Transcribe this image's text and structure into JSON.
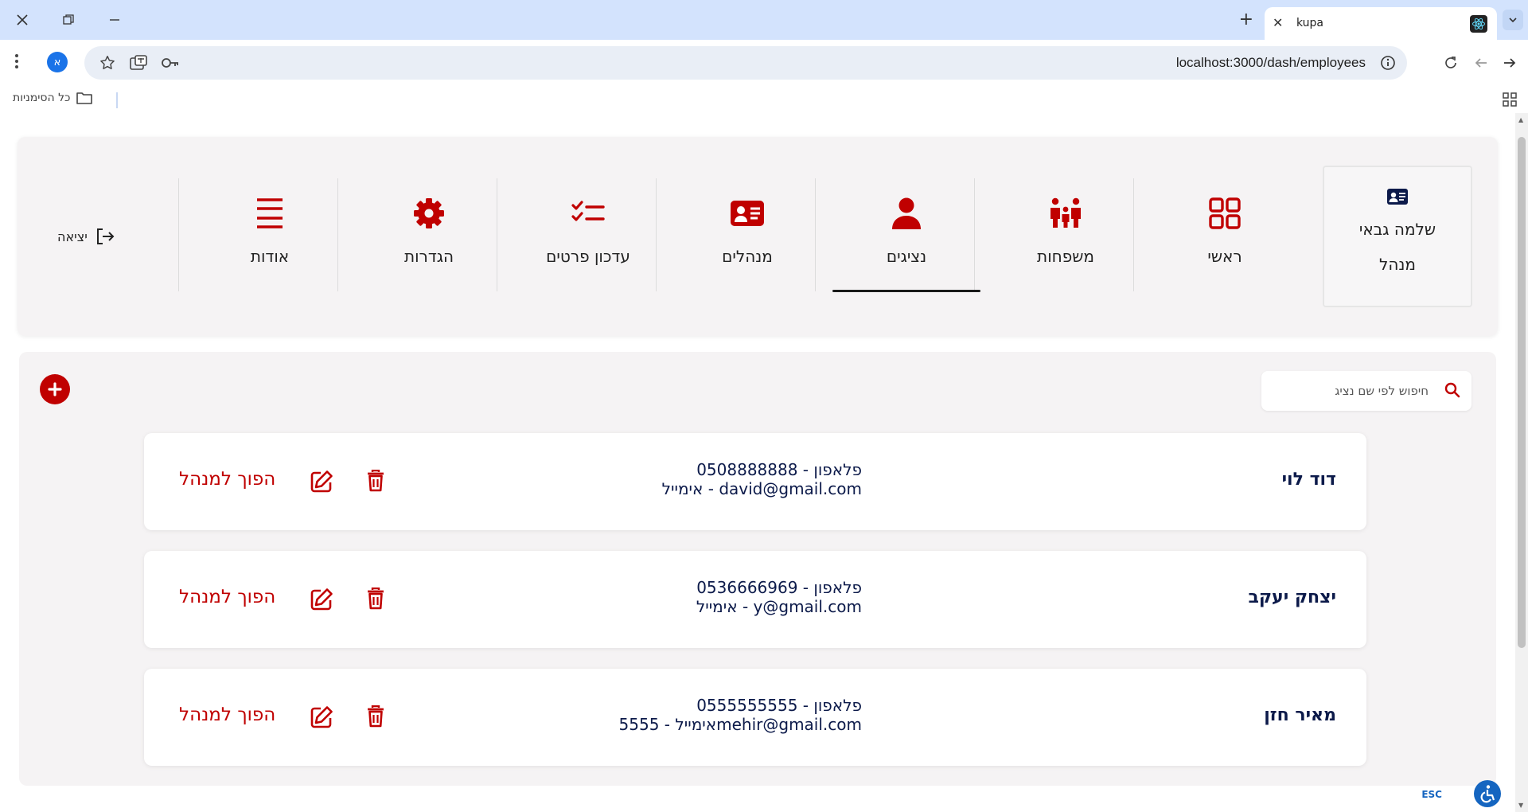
{
  "browser": {
    "tab_title": "kupa",
    "url": "localhost:3000/dash/employees",
    "profile_initial": "א",
    "bookmarks_all_label": "כל הסימניות"
  },
  "user": {
    "name": "שלמה גבאי",
    "role": "מנהל"
  },
  "nav": {
    "items": [
      {
        "label": "ראשי",
        "icon": "grid-icon"
      },
      {
        "label": "משפחות",
        "icon": "family-icon"
      },
      {
        "label": "נציגים",
        "icon": "person-icon",
        "active": true
      },
      {
        "label": "מנהלים",
        "icon": "id-card-icon"
      },
      {
        "label": "עדכון פרטים",
        "icon": "checklist-icon"
      },
      {
        "label": "הגדרות",
        "icon": "gear-icon"
      },
      {
        "label": "אודות",
        "icon": "menu-lines-icon"
      }
    ],
    "logout_label": "יציאה"
  },
  "search": {
    "placeholder": "חיפוש לפי שם נציג",
    "value": ""
  },
  "employees": [
    {
      "name": "דוד לוי",
      "phone_line": "פלאפון - 0508888888",
      "email_line": "אימייל - david@gmail.com",
      "promote_label": "הפוך למנהל"
    },
    {
      "name": "יצחק יעקב",
      "phone_line": "פלאפון - 0536666969",
      "email_line": "אימייל - y@gmail.com",
      "promote_label": "הפוך למנהל"
    },
    {
      "name": "מאיר חזן",
      "phone_line": "פלאפון - 0555555555",
      "email_line": "אימייל - 5555mehir@gmail.com",
      "promote_label": "הפוך למנהל"
    }
  ],
  "accessibility": {
    "esc_label": "ESC"
  },
  "colors": {
    "accent": "#c00000",
    "text_dark": "#0c1a4a",
    "chrome": "#d3e3fd"
  }
}
